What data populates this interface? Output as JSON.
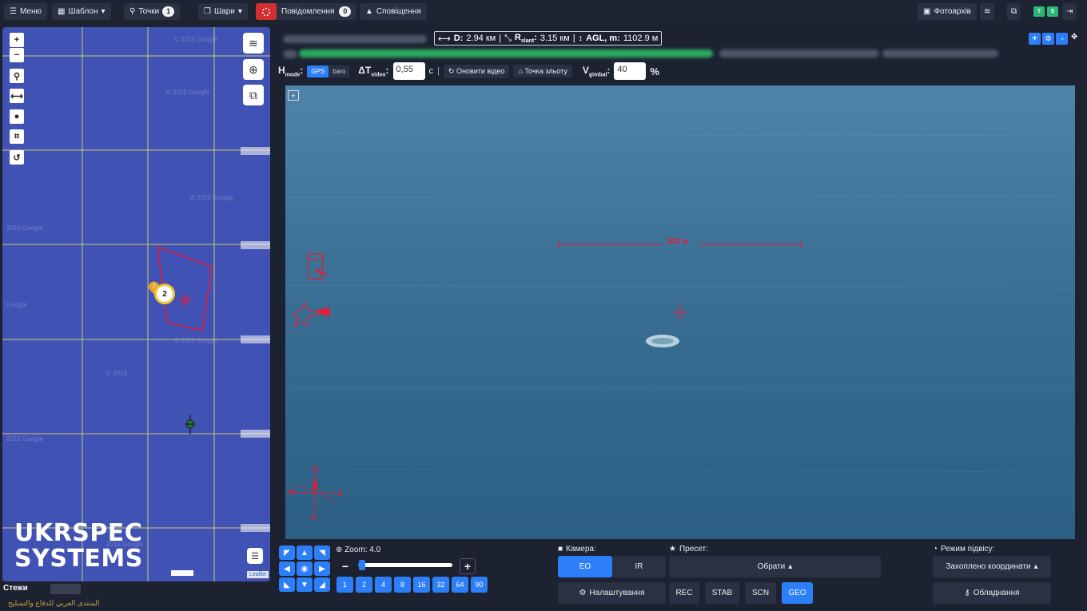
{
  "topbar": {
    "menu_label": "Меню",
    "template_label": "Шаблон",
    "points_label": "Точки",
    "points_count": "1",
    "layers_label": "Шари",
    "messages_label": "Повідомлення",
    "messages_count": "0",
    "alerts_label": "Сповіщення",
    "photo_archive_label": "Фотоархів",
    "status_t": "T",
    "status_s": "S"
  },
  "map": {
    "marker_count": "2",
    "pin_label": "2",
    "attribution": "Leaflet",
    "logo_line1": "UKRSPEC",
    "logo_line2": "SYSTEMS",
    "track_label": "Стежи",
    "arabic_caption": "المنتدى العربي للدفاع والتسليح"
  },
  "video": {
    "metrics": {
      "d_label": "D:",
      "d_value": "2.94 км",
      "r_label": "R",
      "r_sub": "slant",
      "r_value": "3.15 км",
      "agl_label": "AGL, m:",
      "agl_value": "1102.9 м"
    },
    "hmode_label": "H",
    "hmode_sub": "mode",
    "hmode_options": [
      "GPS",
      "baro"
    ],
    "dt_label": "ΔT",
    "dt_sub": "video",
    "dt_value": "0,55",
    "dt_unit": "с",
    "refresh_label": "Оновити відео",
    "point_label": "Точка зльоту",
    "vgimbal_label": "V",
    "vgimbal_sub": "gimbal",
    "vgimbal_value": "40",
    "vgimbal_unit": "%",
    "expand_label": "+",
    "scale_label": "332  м",
    "compass": {
      "n": "N",
      "s": "S",
      "e": "E",
      "w": "W"
    }
  },
  "bottom": {
    "zoom_label": "Zoom: 4.0",
    "zoom_level": 0.04,
    "zoom_presets": [
      "1",
      "2",
      "4",
      "8",
      "16",
      "32",
      "64",
      "90"
    ],
    "camera_label": "Камера:",
    "camera_eo": "EO",
    "camera_ir": "IR",
    "preset_label": "Пресет:",
    "preset_select": "Обрати",
    "settings_label": "Налаштування",
    "rec_label": "REC",
    "stab_label": "STAB",
    "scn_label": "SCN",
    "geo_label": "GEO",
    "gimbal_mode_label": "Режим підвісу:",
    "gimbal_mode_value": "Захоплено координати",
    "equipment_label": "Обладнання"
  }
}
